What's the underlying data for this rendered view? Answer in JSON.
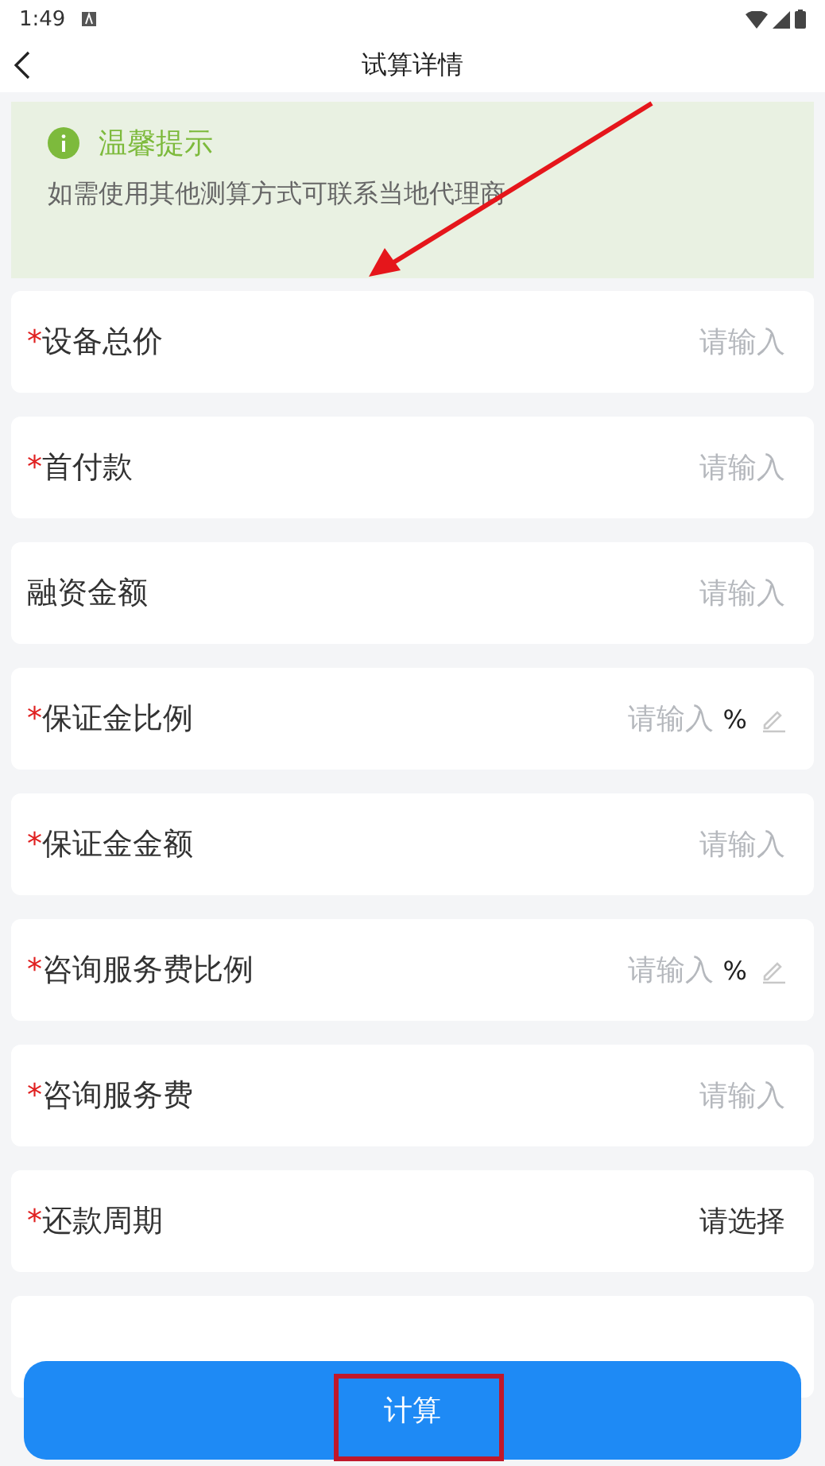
{
  "status_bar": {
    "time": "1:49"
  },
  "header": {
    "title": "试算详情"
  },
  "tip": {
    "title": "温馨提示",
    "text": "如需使用其他测算方式可联系当地代理商"
  },
  "rows": [
    {
      "kind": "input",
      "required_mark": "*",
      "label": "设备总价",
      "placeholder": "请输入"
    },
    {
      "kind": "input",
      "required_mark": "*",
      "label": "首付款",
      "placeholder": "请输入"
    },
    {
      "kind": "input",
      "label": "融资金额",
      "placeholder": "请输入"
    },
    {
      "kind": "percent",
      "required_mark": "*",
      "label": "保证金比例",
      "placeholder": "请输入",
      "unit": "%"
    },
    {
      "kind": "input",
      "required_mark": "*",
      "label": "保证金金额",
      "placeholder": "请输入"
    },
    {
      "kind": "percent",
      "required_mark": "*",
      "label": "咨询服务费比例",
      "placeholder": "请输入",
      "unit": "%"
    },
    {
      "kind": "input",
      "required_mark": "*",
      "label": "咨询服务费",
      "placeholder": "请输入"
    },
    {
      "kind": "select",
      "required_mark": "*",
      "label": "还款周期",
      "value": "请选择"
    },
    {
      "kind": "blank"
    }
  ],
  "action": {
    "label": "计算"
  }
}
